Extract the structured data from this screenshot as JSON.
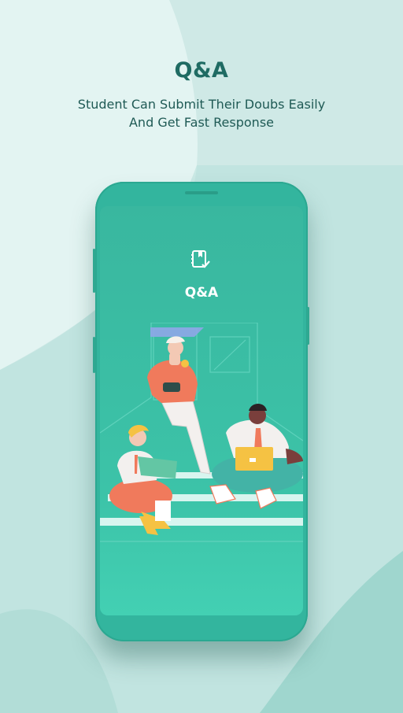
{
  "page": {
    "title": "Q&A",
    "subtitle_lines": [
      "Student Can Submit Their Doubs Easily",
      "And Get Fast Response"
    ]
  },
  "screen": {
    "icon": "notebook-check-icon",
    "title": "Q&A"
  },
  "colors": {
    "background": "#cfe9e6",
    "accent": "#33b59e",
    "heading": "#1f6b63"
  }
}
